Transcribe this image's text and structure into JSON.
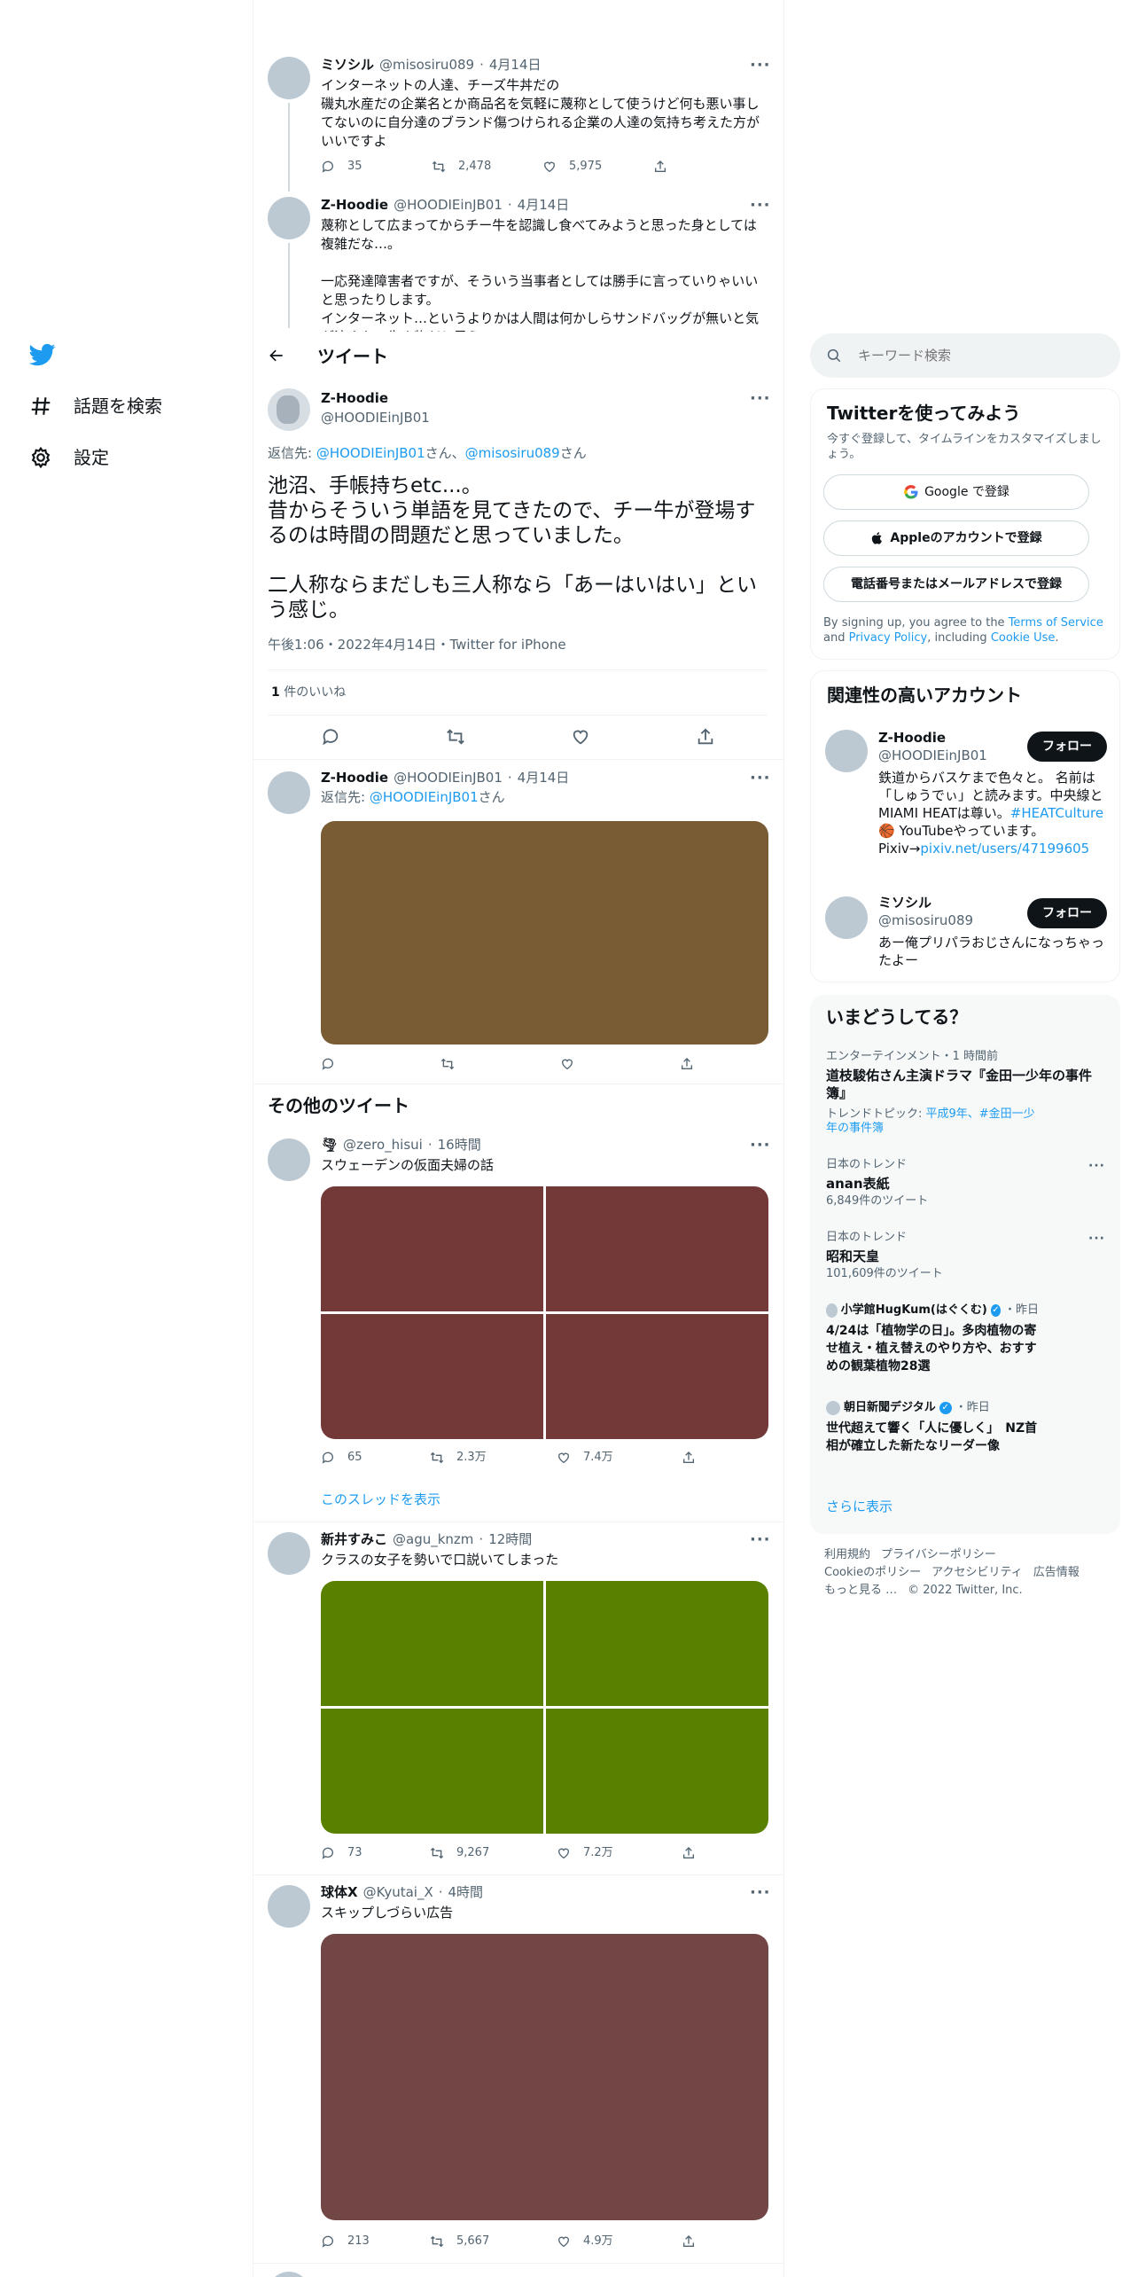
{
  "nav": {
    "explore_label": "話題を検索",
    "settings_label": "設定"
  },
  "header": {
    "title": "ツイート"
  },
  "thread": [
    {
      "name": "ミソシル",
      "handle": "@misosiru089",
      "date": "4月14日",
      "text": "インターネットの人達、チーズ牛丼だの\n磯丸水産だの企業名とか商品名を気軽に蔑称として使うけど何も悪い事してないのに自分達のブランド傷つけられる企業の人達の気持ち考えた方がいいですよ",
      "replies": "35",
      "retweets": "2,478",
      "likes": "5,975"
    },
    {
      "name": "Z-Hoodie",
      "handle": "@HOODIEinJB01",
      "date": "4月14日",
      "text": "蔑称として広まってからチー牛を認識し食べてみようと思った身としては複雑だな…。\n\n一応発達障害者ですが、そういう当事者としては勝手に言っていりゃいいと思ったりします。\nインターネット…というよりかは人間は何かしらサンドバッグが無いと気が済まない生き物だと思うので"
    }
  ],
  "main_tweet": {
    "name": "Z-Hoodie",
    "handle": "@HOODIEinJB01",
    "reply_prefix": "返信先: ",
    "reply_to_1": "@HOODIEinJB01",
    "reply_san_1": "さん、",
    "reply_to_2": "@misosiru089",
    "reply_san_2": "さん",
    "text": "池沼、手帳持ちetc...。\n昔からそういう単語を見てきたので、チー牛が登場するのは時間の問題だと思っていました。\n\n二人称ならまだしも三人称なら「あーはいはい」という感じ。",
    "meta": "午後1:06・2022年4月14日・Twitter for iPhone",
    "likes_count": "1",
    "likes_label": " 件のいいね"
  },
  "reply_tweet": {
    "name": "Z-Hoodie",
    "handle": "@HOODIEinJB01",
    "date": "4月14日",
    "reply_prefix": "返信先: ",
    "reply_to": "@HOODIEinJB01",
    "reply_san": "さん",
    "image_color": "#7a5c34"
  },
  "more_tweets_title": "その他のツイート",
  "more_tweets": [
    {
      "name": "🌪",
      "handle": "@zero_hisui",
      "date": "16時間",
      "text": "スウェーデンの仮面夫婦の話",
      "replies": "65",
      "retweets": "2.3万",
      "likes": "7.4万",
      "image_color": "#733939",
      "show_thread": "このスレッドを表示"
    },
    {
      "name": "新井すみこ",
      "handle": "@agu_knzm",
      "date": "12時間",
      "text": "クラスの女子を勢いで口説いてしまった",
      "replies": "73",
      "retweets": "9,267",
      "likes": "7.2万",
      "image_color": "#5a8000"
    },
    {
      "name": "球体X",
      "handle": "@Kyutai_X",
      "date": "4時間",
      "text": "スキップしづらい広告",
      "replies": "213",
      "retweets": "5,667",
      "likes": "4.9万",
      "image_color": "#734646"
    }
  ],
  "search": {
    "placeholder": "キーワード検索"
  },
  "signup": {
    "title": "Twitterを使ってみよう",
    "subtitle": "今すぐ登録して、タイムラインをカスタマイズしましょう。",
    "google": "Google で登録",
    "apple": "Appleのアカウントで登録",
    "phone": "電話番号またはメールアドレスで登録",
    "terms_1": "By signing up, you agree to the ",
    "terms_link": "Terms of Service",
    "terms_2": " and ",
    "privacy_link": "Privacy Policy",
    "terms_3": ", including ",
    "cookie_link": "Cookie Use",
    "terms_4": "."
  },
  "relevant": {
    "title": "関連性の高いアカウント",
    "follow_label": "フォロー",
    "accounts": [
      {
        "name": "Z-Hoodie",
        "handle": "@HOODIEinJB01",
        "bio_1": "鉄道からバスケまで色々と。 名前は「しゅうでぃ」と読みます。中央線とMIAMI HEATは尊い。",
        "bio_tag": "#HEATCulture",
        "bio_2": "🏀 YouTubeやっています。Pixiv→",
        "bio_link": "pixiv.net/users/47199605"
      },
      {
        "name": "ミソシル",
        "handle": "@misosiru089",
        "bio_1": "あー俺プリパラおじさんになっちゃったよー"
      }
    ]
  },
  "trends": {
    "title": "いまどうしてる？",
    "items": [
      {
        "category": "エンターテインメント・1 時間前",
        "title": "道枝駿佑さん主演ドラマ『金田一少年の事件簿』",
        "sub_prefix": "トレンドトピック: ",
        "sub_links": "平成9年、#金田一少年の事件簿"
      },
      {
        "category": "日本のトレンド",
        "title": "anan表紙",
        "count": "6,849件のツイート"
      },
      {
        "category": "日本のトレンド",
        "title": "昭和天皇",
        "count": "101,609件のツイート"
      },
      {
        "source": "小学館HugKum(はぐくむ)",
        "time": "・昨日",
        "title": "4/24は「植物学の日」。多肉植物の寄せ植え・植え替えのやり方や、おすすめの観葉植物28選"
      },
      {
        "source": "朝日新聞デジタル",
        "time": "・昨日",
        "title": "世代超えて響く「人に優しく」　NZ首相が確立した新たなリーダー像"
      }
    ],
    "show_more": "さらに表示"
  },
  "footer": {
    "links_1": [
      "利用規約",
      "プライバシーポリシー"
    ],
    "links_2": [
      "Cookieのポリシー",
      "アクセシビリティ",
      "広告情報"
    ],
    "more": "もっと見る …",
    "copyright": "© 2022 Twitter, Inc."
  },
  "colors": {
    "brand": "#1d9bf0",
    "text": "#0f1419",
    "muted": "#536471"
  }
}
